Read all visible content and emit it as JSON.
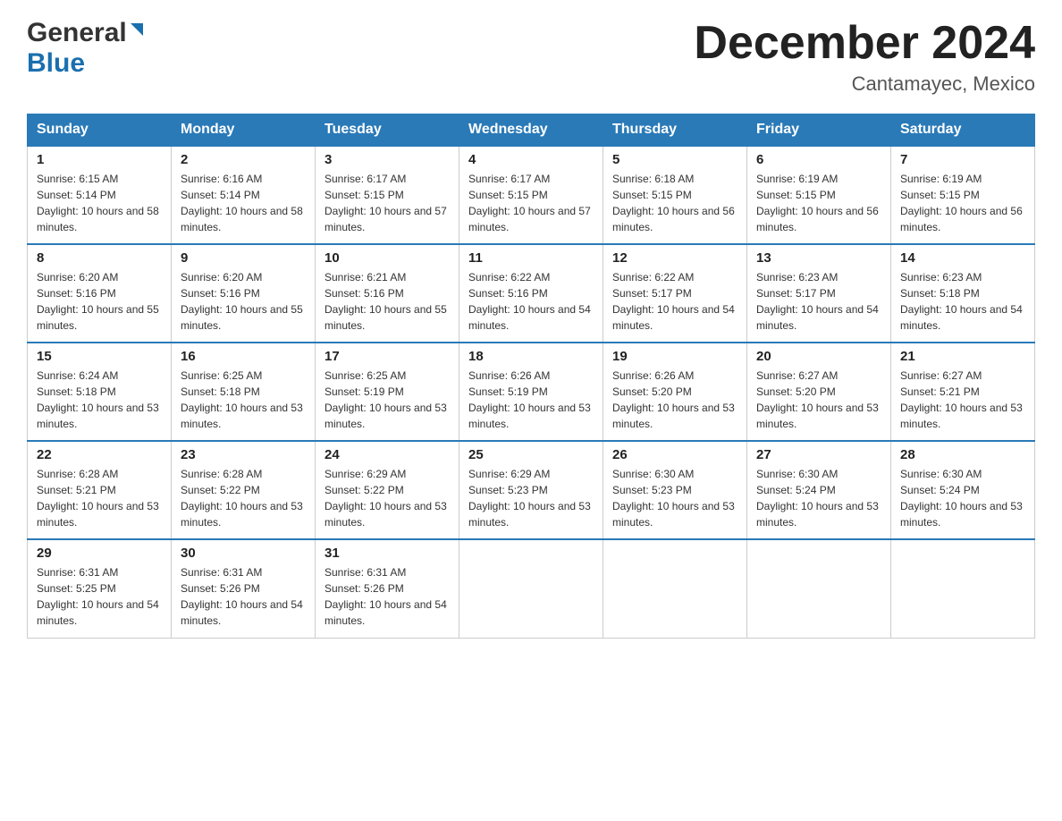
{
  "header": {
    "logo_general": "General",
    "logo_blue": "Blue",
    "month_title": "December 2024",
    "location": "Cantamayec, Mexico"
  },
  "calendar": {
    "days_of_week": [
      "Sunday",
      "Monday",
      "Tuesday",
      "Wednesday",
      "Thursday",
      "Friday",
      "Saturday"
    ],
    "weeks": [
      [
        {
          "day": "1",
          "sunrise": "6:15 AM",
          "sunset": "5:14 PM",
          "daylight": "10 hours and 58 minutes."
        },
        {
          "day": "2",
          "sunrise": "6:16 AM",
          "sunset": "5:14 PM",
          "daylight": "10 hours and 58 minutes."
        },
        {
          "day": "3",
          "sunrise": "6:17 AM",
          "sunset": "5:15 PM",
          "daylight": "10 hours and 57 minutes."
        },
        {
          "day": "4",
          "sunrise": "6:17 AM",
          "sunset": "5:15 PM",
          "daylight": "10 hours and 57 minutes."
        },
        {
          "day": "5",
          "sunrise": "6:18 AM",
          "sunset": "5:15 PM",
          "daylight": "10 hours and 56 minutes."
        },
        {
          "day": "6",
          "sunrise": "6:19 AM",
          "sunset": "5:15 PM",
          "daylight": "10 hours and 56 minutes."
        },
        {
          "day": "7",
          "sunrise": "6:19 AM",
          "sunset": "5:15 PM",
          "daylight": "10 hours and 56 minutes."
        }
      ],
      [
        {
          "day": "8",
          "sunrise": "6:20 AM",
          "sunset": "5:16 PM",
          "daylight": "10 hours and 55 minutes."
        },
        {
          "day": "9",
          "sunrise": "6:20 AM",
          "sunset": "5:16 PM",
          "daylight": "10 hours and 55 minutes."
        },
        {
          "day": "10",
          "sunrise": "6:21 AM",
          "sunset": "5:16 PM",
          "daylight": "10 hours and 55 minutes."
        },
        {
          "day": "11",
          "sunrise": "6:22 AM",
          "sunset": "5:16 PM",
          "daylight": "10 hours and 54 minutes."
        },
        {
          "day": "12",
          "sunrise": "6:22 AM",
          "sunset": "5:17 PM",
          "daylight": "10 hours and 54 minutes."
        },
        {
          "day": "13",
          "sunrise": "6:23 AM",
          "sunset": "5:17 PM",
          "daylight": "10 hours and 54 minutes."
        },
        {
          "day": "14",
          "sunrise": "6:23 AM",
          "sunset": "5:18 PM",
          "daylight": "10 hours and 54 minutes."
        }
      ],
      [
        {
          "day": "15",
          "sunrise": "6:24 AM",
          "sunset": "5:18 PM",
          "daylight": "10 hours and 53 minutes."
        },
        {
          "day": "16",
          "sunrise": "6:25 AM",
          "sunset": "5:18 PM",
          "daylight": "10 hours and 53 minutes."
        },
        {
          "day": "17",
          "sunrise": "6:25 AM",
          "sunset": "5:19 PM",
          "daylight": "10 hours and 53 minutes."
        },
        {
          "day": "18",
          "sunrise": "6:26 AM",
          "sunset": "5:19 PM",
          "daylight": "10 hours and 53 minutes."
        },
        {
          "day": "19",
          "sunrise": "6:26 AM",
          "sunset": "5:20 PM",
          "daylight": "10 hours and 53 minutes."
        },
        {
          "day": "20",
          "sunrise": "6:27 AM",
          "sunset": "5:20 PM",
          "daylight": "10 hours and 53 minutes."
        },
        {
          "day": "21",
          "sunrise": "6:27 AM",
          "sunset": "5:21 PM",
          "daylight": "10 hours and 53 minutes."
        }
      ],
      [
        {
          "day": "22",
          "sunrise": "6:28 AM",
          "sunset": "5:21 PM",
          "daylight": "10 hours and 53 minutes."
        },
        {
          "day": "23",
          "sunrise": "6:28 AM",
          "sunset": "5:22 PM",
          "daylight": "10 hours and 53 minutes."
        },
        {
          "day": "24",
          "sunrise": "6:29 AM",
          "sunset": "5:22 PM",
          "daylight": "10 hours and 53 minutes."
        },
        {
          "day": "25",
          "sunrise": "6:29 AM",
          "sunset": "5:23 PM",
          "daylight": "10 hours and 53 minutes."
        },
        {
          "day": "26",
          "sunrise": "6:30 AM",
          "sunset": "5:23 PM",
          "daylight": "10 hours and 53 minutes."
        },
        {
          "day": "27",
          "sunrise": "6:30 AM",
          "sunset": "5:24 PM",
          "daylight": "10 hours and 53 minutes."
        },
        {
          "day": "28",
          "sunrise": "6:30 AM",
          "sunset": "5:24 PM",
          "daylight": "10 hours and 53 minutes."
        }
      ],
      [
        {
          "day": "29",
          "sunrise": "6:31 AM",
          "sunset": "5:25 PM",
          "daylight": "10 hours and 54 minutes."
        },
        {
          "day": "30",
          "sunrise": "6:31 AM",
          "sunset": "5:26 PM",
          "daylight": "10 hours and 54 minutes."
        },
        {
          "day": "31",
          "sunrise": "6:31 AM",
          "sunset": "5:26 PM",
          "daylight": "10 hours and 54 minutes."
        },
        null,
        null,
        null,
        null
      ]
    ]
  }
}
